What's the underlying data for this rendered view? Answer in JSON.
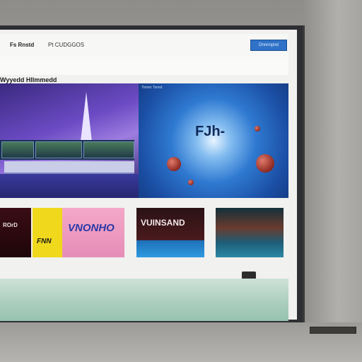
{
  "header": {
    "logo_text": "Fs Rnstd",
    "nav_text": "Pt CUDGGOS",
    "action_button": "Dnnnnpnd"
  },
  "section": {
    "title": "Wyyedd Hllmmedd"
  },
  "hero": {
    "right_label": "Ttmnrr Tsnnd",
    "right_title": "FJh-"
  },
  "tiles": [
    {
      "text": "ROrD"
    },
    {
      "text": "FNN"
    },
    {
      "text": "VNONHO"
    },
    {
      "text": "VUINSAND"
    },
    {
      "text": ""
    }
  ],
  "colors": {
    "accent_button": "#2f72c8",
    "hero_left": "#6c4bc4",
    "hero_right": "#2f79d1",
    "footer": "#a9cdbd"
  },
  "icons": {
    "scroll_indicator": "scroll-down-icon"
  }
}
